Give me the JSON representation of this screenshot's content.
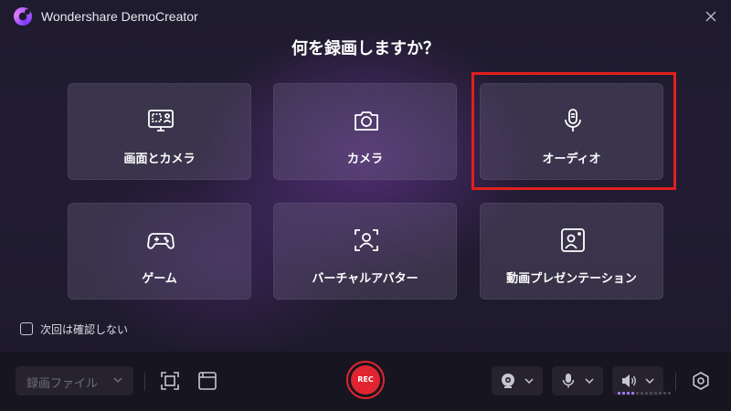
{
  "window": {
    "title": "Wondershare DemoCreator"
  },
  "heading": "何を録画しますか？",
  "options": [
    {
      "label": "画面とカメラ",
      "icon": "screen-camera-icon"
    },
    {
      "label": "カメラ",
      "icon": "camera-icon"
    },
    {
      "label": "オーディオ",
      "icon": "microphone-icon",
      "highlighted": true
    },
    {
      "label": "ゲーム",
      "icon": "gamepad-icon"
    },
    {
      "label": "バーチャルアバター",
      "icon": "virtual-avatar-icon"
    },
    {
      "label": "動画プレゼンテーション",
      "icon": "presentation-icon"
    }
  ],
  "dont_ask_again": {
    "label": "次回は確認しない",
    "checked": false
  },
  "bottombar": {
    "record_mode": {
      "value": "録画ファイル"
    },
    "rec_label": "REC",
    "devices": [
      "webcam-icon",
      "microphone-icon",
      "speaker-icon"
    ],
    "audio_level_fraction": 0.33
  },
  "colors": {
    "accent": "#a37cff",
    "rec": "#e02530",
    "highlight": "#e0201f"
  }
}
